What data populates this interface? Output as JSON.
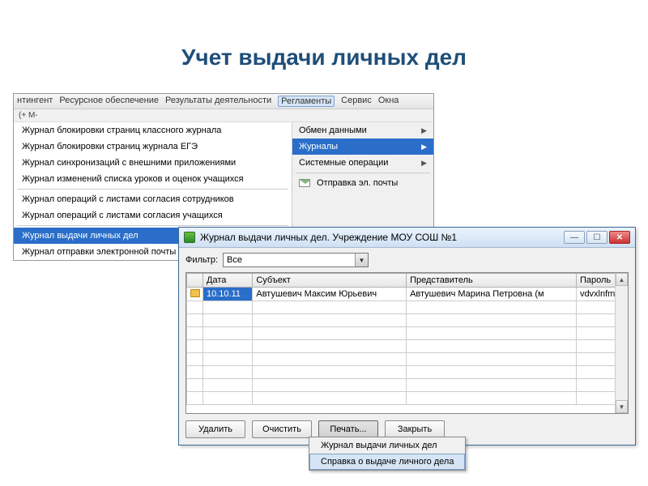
{
  "slide_title": "Учет выдачи личных дел",
  "menubar": {
    "items": [
      "нтингент",
      "Ресурсное обеспечение",
      "Результаты деятельности",
      "Регламенты",
      "Сервис",
      "Окна"
    ],
    "active_index": 3,
    "toolbar_text": "(+  М-"
  },
  "submenu": {
    "items": [
      {
        "label": "Обмен данными",
        "has_arrow": true
      },
      {
        "label": "Журналы",
        "has_arrow": true,
        "highlight": true
      },
      {
        "label": "Системные операции",
        "has_arrow": true
      }
    ],
    "mail_label": "Отправка эл. почты"
  },
  "journal_menu": {
    "group1": [
      "Журнал блокировки страниц классного журнала",
      "Журнал блокировки страниц журнала ЕГЭ",
      "Журнал синхронизаций с внешними приложениями",
      "Журнал изменений списка уроков и оценок учащихся"
    ],
    "group2": [
      "Журнал операций с листами согласия сотрудников",
      "Журнал операций с листами согласия учащихся"
    ],
    "group3": [
      "Журнал выдачи личных дел",
      "Журнал отправки электронной почты"
    ],
    "highlight_index": 0
  },
  "window": {
    "title": "Журнал выдачи личных дел. Учреждение МОУ СОШ №1",
    "filter_label": "Фильтр:",
    "filter_value": "Все",
    "columns": [
      "Дата",
      "Субъект",
      "Представитель",
      "Пароль"
    ],
    "rows": [
      {
        "date": "10.10.11",
        "subject": "Автушевич Максим Юрьевич",
        "rep": "Автушевич Марина Петровна (м",
        "pwd": "vdvxlnfm"
      }
    ],
    "buttons": {
      "delete": "Удалить",
      "clear": "Очистить",
      "print": "Печать...",
      "close": "Закрыть"
    },
    "print_menu": [
      "Журнал выдачи личных дел",
      "Справка о выдаче личного дела"
    ],
    "print_menu_hover_index": 1
  }
}
